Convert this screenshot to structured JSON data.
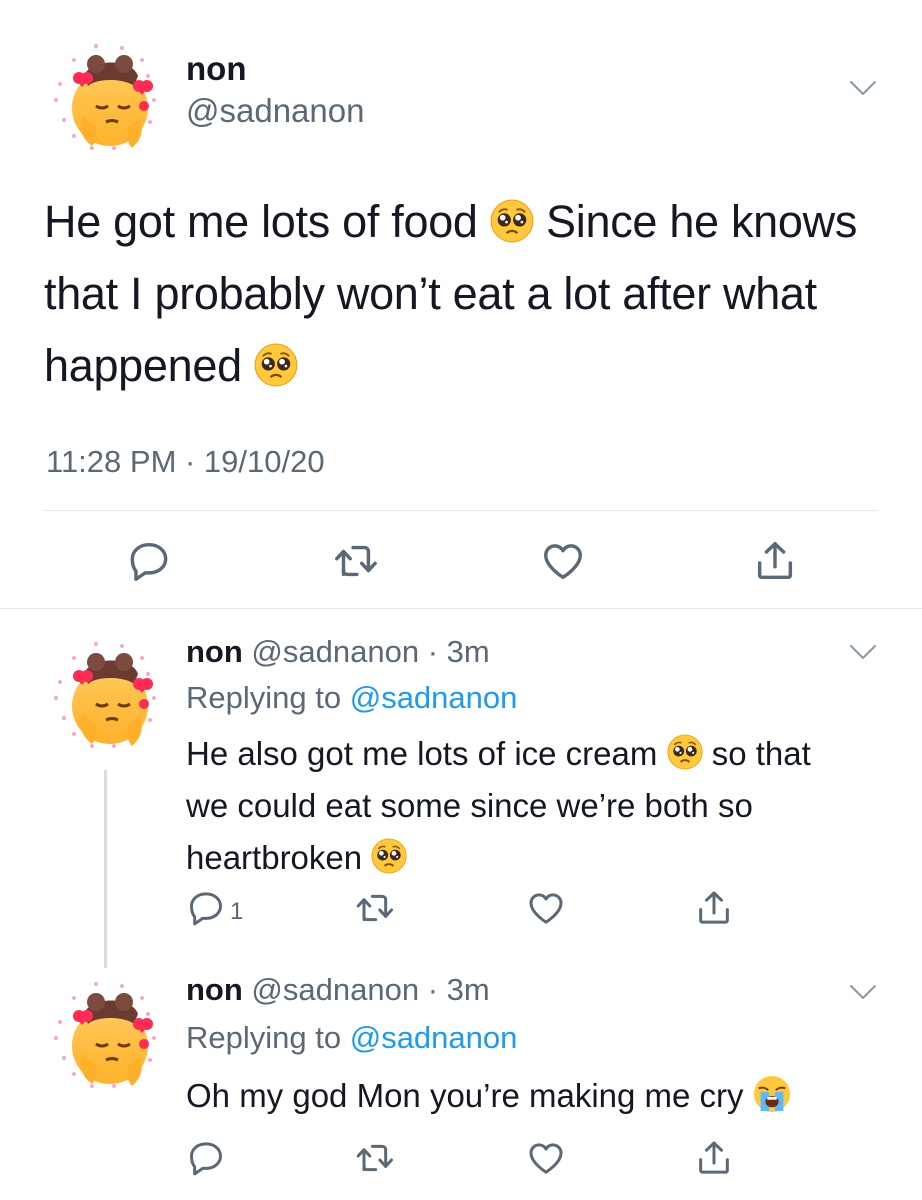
{
  "main_tweet": {
    "display_name": "non",
    "handle": "@sadnanon",
    "text_parts": [
      "He got me lots of food ",
      " Since he knows that I probably won’t eat a lot after what happened "
    ],
    "timestamp": "11:28 PM · 19/10/20"
  },
  "replies": [
    {
      "display_name": "non",
      "meta": " @sadnanon · 3m",
      "replying_label": "Replying to ",
      "replying_handle": "@sadnanon",
      "text_parts": [
        "He also got me lots of ice cream ",
        " so that we could eat some since we’re both so heartbroken "
      ],
      "reply_count": "1"
    },
    {
      "display_name": "non",
      "meta": " @sadnanon · 3m",
      "replying_label": "Replying to ",
      "replying_handle": "@sadnanon",
      "text_parts": [
        "Oh my god Mon you’re making me cry "
      ]
    }
  ],
  "icons": {
    "reply": "reply-icon",
    "retweet": "retweet-icon",
    "like": "like-icon",
    "share": "share-icon",
    "chevron": "chevron-down-icon",
    "pleading_emoji": "pleading-face-emoji",
    "crying_emoji": "loudly-crying-face-emoji"
  },
  "colors": {
    "text": "#141823",
    "secondary": "#5b6875",
    "link": "#1d9bf0",
    "divider": "#e1e8ed"
  }
}
